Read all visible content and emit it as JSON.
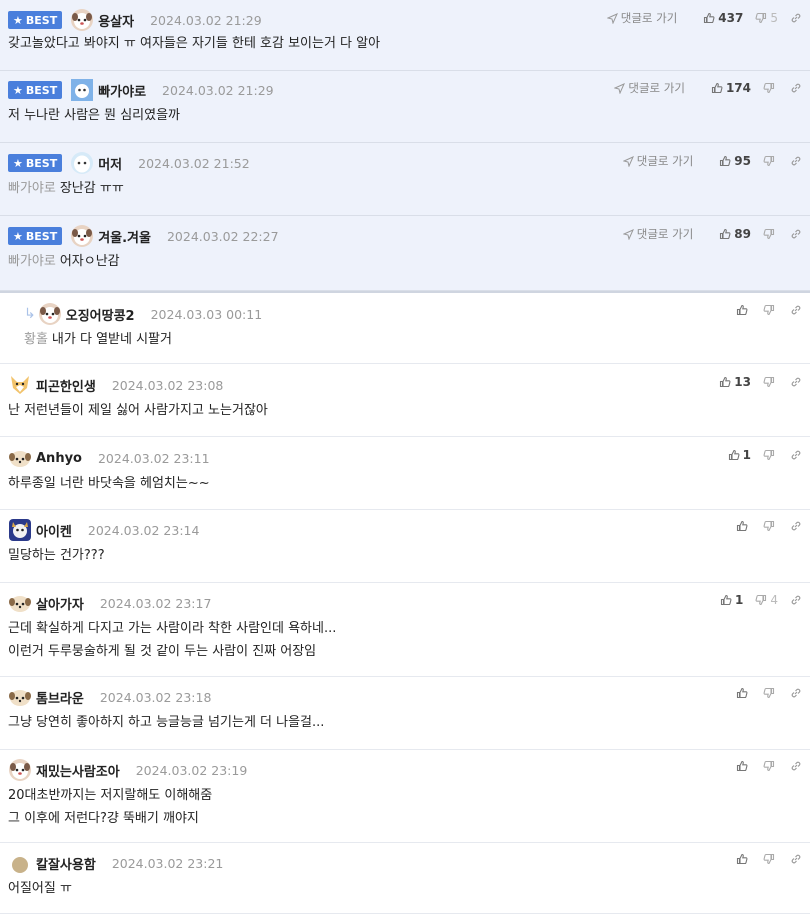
{
  "comments": [
    {
      "best": true,
      "nickname": "용살자",
      "date": "2024.03.02 21:29",
      "goto": "댓글로 가기",
      "likes": "437",
      "dislikes": "5",
      "mention": "",
      "lines": [
        "갖고놀았다고 봐야지 ㅠ 여자들은 자기들 한테 호감 보이는거 다 알아"
      ],
      "avatar": "dog"
    },
    {
      "best": true,
      "nickname": "빠가야로",
      "date": "2024.03.02 21:29",
      "goto": "댓글로 가기",
      "likes": "174",
      "dislikes": "",
      "mention": "",
      "lines": [
        "저 누나란 사람은 뭔 심리였을까"
      ],
      "avatar": "blue"
    },
    {
      "best": true,
      "nickname": "머저",
      "date": "2024.03.02 21:52",
      "goto": "댓글로 가기",
      "likes": "95",
      "dislikes": "",
      "mention": "빠가야로",
      "lines": [
        "장난감 ㅠㅠ"
      ],
      "avatar": "seal"
    },
    {
      "best": true,
      "nickname": "겨울.겨울",
      "date": "2024.03.02 22:27",
      "goto": "댓글로 가기",
      "likes": "89",
      "dislikes": "",
      "mention": "빠가야로",
      "lines": [
        "어자ㅇ난감"
      ],
      "avatar": "dog"
    },
    {
      "best": false,
      "reply": true,
      "nickname": "오징어땅콩2",
      "date": "2024.03.03 00:11",
      "goto": "",
      "likes": "",
      "dislikes": "",
      "mention": "황홀",
      "lines": [
        "내가 다 열받네 시팔거"
      ],
      "avatar": "dog"
    },
    {
      "best": false,
      "nickname": "피곤한인생",
      "date": "2024.03.02 23:08",
      "goto": "",
      "likes": "13",
      "dislikes": "",
      "mention": "",
      "lines": [
        "난 저런년들이 제일 싫어 사람가지고 노는거잖아"
      ],
      "avatar": "fox"
    },
    {
      "best": false,
      "nickname": "Anhyo",
      "date": "2024.03.02 23:11",
      "goto": "",
      "likes": "1",
      "dislikes": "",
      "mention": "",
      "lines": [
        "하루종일 너란 바닷속을 헤엄치는~~"
      ],
      "avatar": "puppy"
    },
    {
      "best": false,
      "nickname": "아이켄",
      "date": "2024.03.02 23:14",
      "goto": "",
      "likes": "",
      "dislikes": "",
      "mention": "",
      "lines": [
        "밀당하는 건가???"
      ],
      "avatar": "cat"
    },
    {
      "best": false,
      "nickname": "살아가자",
      "date": "2024.03.02 23:17",
      "goto": "",
      "likes": "1",
      "dislikes": "4",
      "mention": "",
      "lines": [
        "근데 확실하게 다지고 가는 사람이라 착한 사람인데 욕하네...",
        "이런거 두루뭉술하게 될 것 같이 두는 사람이 진짜 어장임"
      ],
      "avatar": "puppy"
    },
    {
      "best": false,
      "nickname": "톰브라운",
      "date": "2024.03.02 23:18",
      "goto": "",
      "likes": "",
      "dislikes": "",
      "mention": "",
      "lines": [
        "그냥 당연히 좋아하지 하고 능글능글 넘기는게 더 나을걸..."
      ],
      "avatar": "puppy"
    },
    {
      "best": false,
      "nickname": "재밌는사람조아",
      "date": "2024.03.02 23:19",
      "goto": "",
      "likes": "",
      "dislikes": "",
      "mention": "",
      "lines": [
        "20대초반까지는 저지랄해도 이해해줌",
        "그 이후에 저런다?걍 뚝배기 깨야지"
      ],
      "avatar": "dog"
    },
    {
      "best": false,
      "nickname": "칼잘사용함",
      "date": "2024.03.02 23:21",
      "goto": "",
      "likes": "",
      "dislikes": "",
      "mention": "",
      "lines": [
        "어질어질 ㅠ"
      ],
      "avatar": "circle"
    }
  ],
  "best_label": "BEST",
  "colors": {
    "best_bg": "#eef2fb",
    "badge": "#4a7fdc",
    "divider": "#e6e9ef"
  }
}
